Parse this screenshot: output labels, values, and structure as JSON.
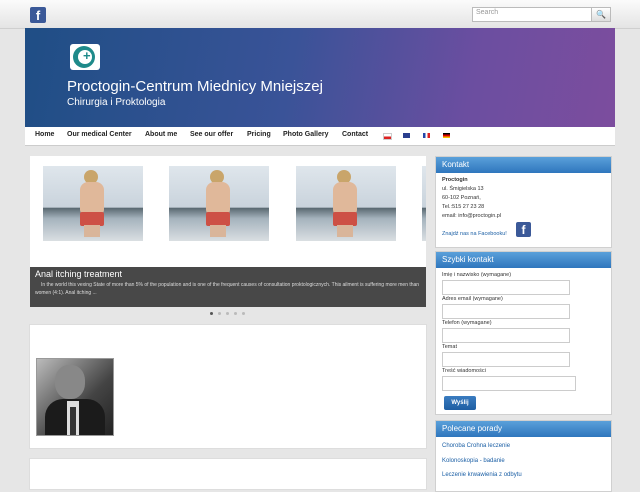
{
  "topbar": {
    "facebook_icon": "facebook-icon",
    "search_placeholder": "Search",
    "search_button_icon": "search-icon"
  },
  "header": {
    "title": "Proctogin-Centrum Miednicy Mniejszej",
    "subtitle": "Chirurgia i Proktologia"
  },
  "nav": {
    "items": [
      "Home",
      "Our medical Center",
      "About me",
      "See our offer",
      "Pricing",
      "Photo Gallery",
      "Contact"
    ],
    "flags": [
      "polish-flag-icon",
      "english-flag-icon",
      "french-flag-icon",
      "german-flag-icon"
    ]
  },
  "slider": {
    "caption_title": "Anal itching treatment",
    "caption_text": "In the world this vexing State of more than 5% of the population and is one of the frequent causes of consultation proktologicznych. This ailment is suffering more men than women (4:1). Anal itching ...",
    "dot_count": 5,
    "active_dot": 1
  },
  "kontakt": {
    "heading": "Kontakt",
    "name": "Proctogin",
    "street": "ul. Śmigielska 13",
    "city": "60-102 Poznań,",
    "tel": "Tel.:515 27 23 28",
    "email": "email: info@proctogin.pl",
    "facebook_link": "Znajdź nas na Facebooku!"
  },
  "quick_contact": {
    "heading": "Szybki kontakt",
    "name_label": "Imię i nazwisko (wymagane)",
    "email_label": "Adres email (wymagane)",
    "phone_label": "Telefon (wymagane)",
    "subject_label": "Temat",
    "message_label": "Treść wiadomości",
    "send_label": "Wyślij"
  },
  "advice": {
    "heading": "Polecane porady",
    "items": [
      "Choroba Crohna leczenie",
      "Kolonoskopia - badanie",
      "Leczenie krwawienia z odbytu"
    ]
  }
}
